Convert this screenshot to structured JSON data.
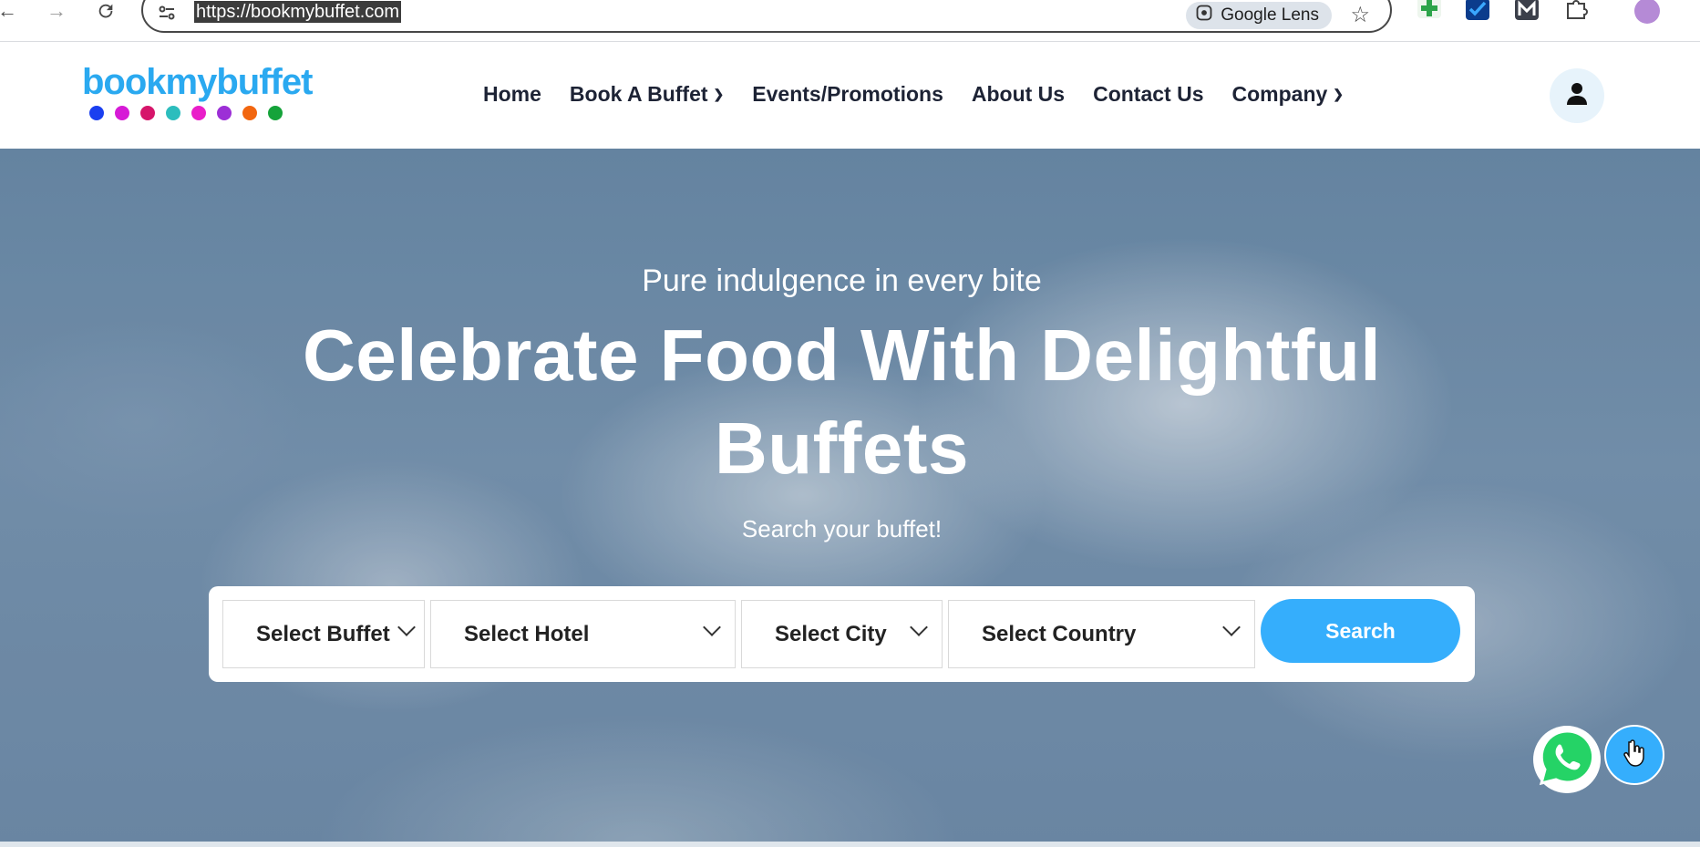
{
  "browser": {
    "url": "https://bookmybuffet.com",
    "lens_label": "Google Lens",
    "icons": [
      "back-icon",
      "forward-icon",
      "reload-icon",
      "site-settings-icon",
      "bookmark-star-icon",
      "extensions-icon",
      "profile-avatar"
    ]
  },
  "site": {
    "logo_text": "bookmybuffet",
    "logo_dot_colors": [
      "#1a3ff0",
      "#d61ad6",
      "#d6156a",
      "#2cbdbd",
      "#e91ec9",
      "#9c2fd6",
      "#f2660f",
      "#15a33a"
    ],
    "nav": {
      "home": "Home",
      "book_buffet": "Book A Buffet",
      "events": "Events/Promotions",
      "about": "About Us",
      "contact": "Contact Us",
      "company": "Company"
    },
    "accent_color": "#35aefc"
  },
  "hero": {
    "tagline": "Pure indulgence in every bite",
    "headline": "Celebrate Food With Delightful Buffets",
    "subline": "Search your buffet!"
  },
  "search": {
    "buffet": "Select Buffet",
    "hotel": "Select Hotel",
    "city": "Select City",
    "country": "Select Country",
    "button": "Search"
  }
}
